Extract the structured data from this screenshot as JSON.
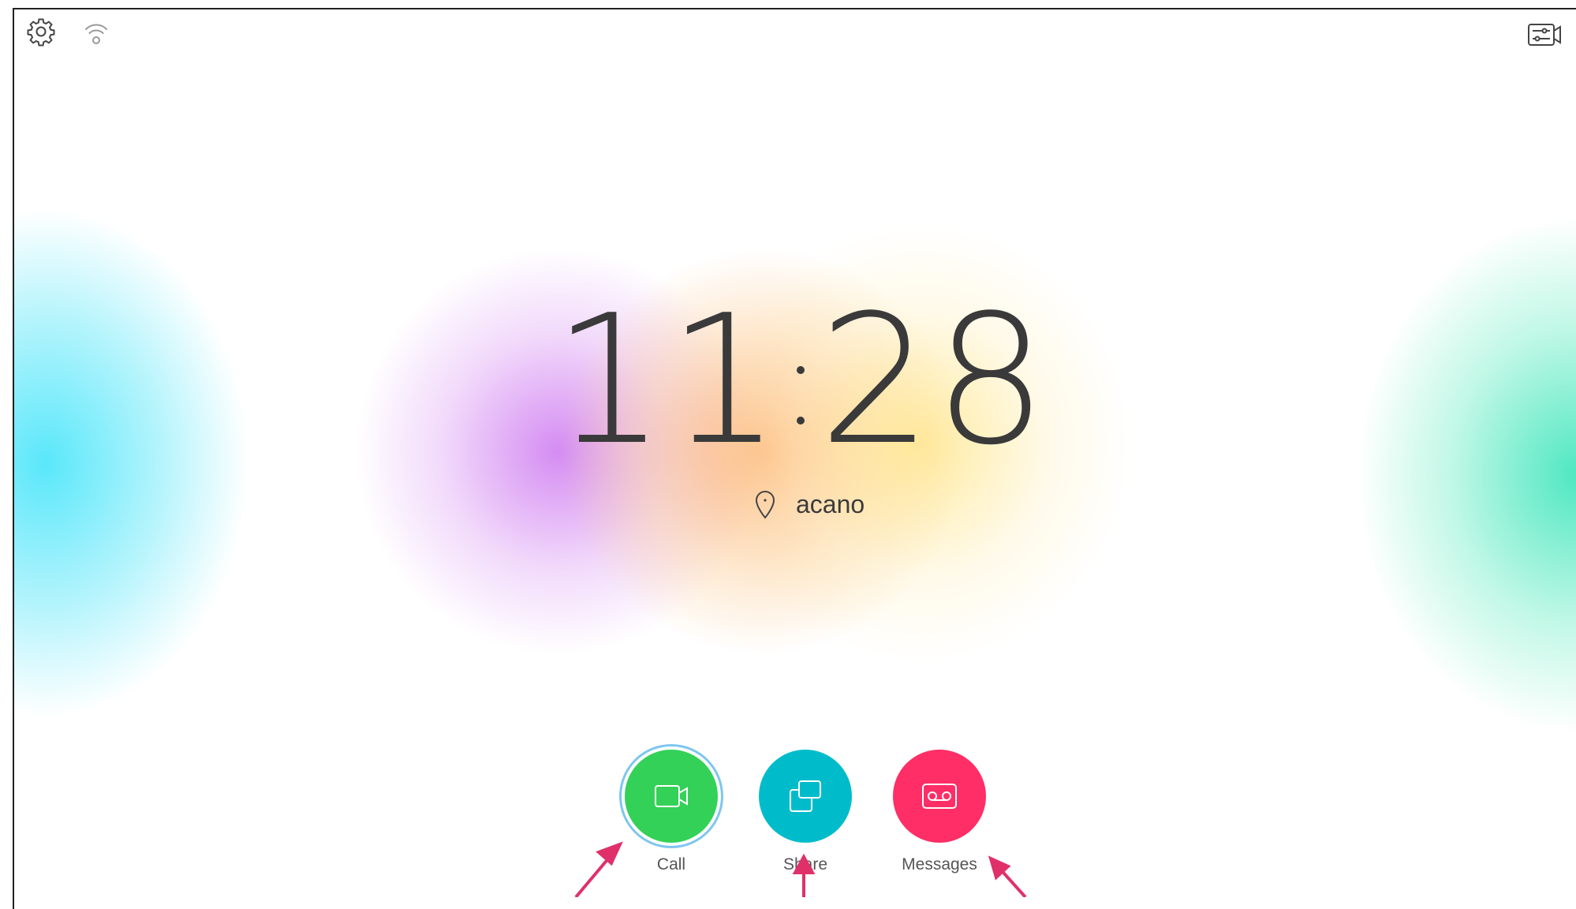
{
  "clock": {
    "hours": "11",
    "minutes": "28"
  },
  "location": {
    "name": "acano",
    "icon": "location-pin-icon"
  },
  "topbar": {
    "left_icons": [
      "gear-icon",
      "wifi-icon"
    ],
    "right_icon": "control-panel-icon"
  },
  "actions": [
    {
      "label": "Call",
      "icon": "video-camera-icon",
      "color": "#34d158"
    },
    {
      "label": "Share",
      "icon": "share-screens-icon",
      "color": "#00bccb"
    },
    {
      "label": "Messages",
      "icon": "voicemail-icon",
      "color": "#ff2e66"
    }
  ],
  "annotation_color": "#e0306a"
}
